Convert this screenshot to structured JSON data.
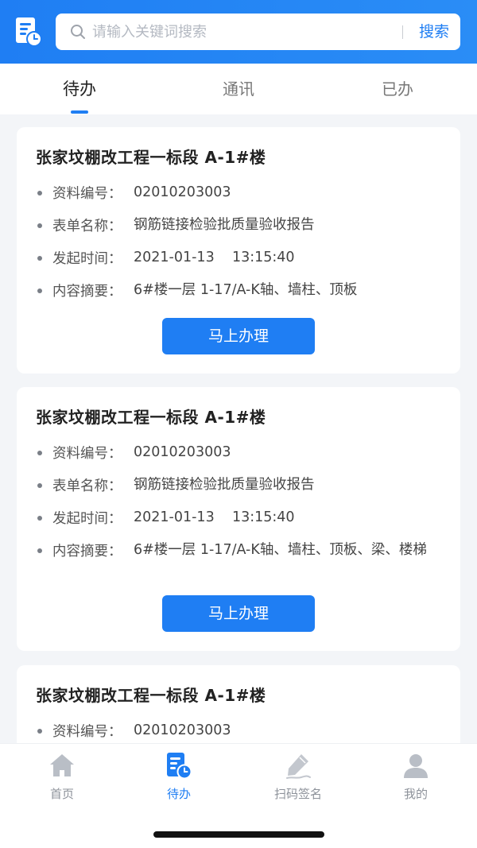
{
  "search": {
    "placeholder": "请输入关键词搜索",
    "button_label": "搜索"
  },
  "tabs": [
    {
      "label": "待办",
      "active": true
    },
    {
      "label": "通讯",
      "active": false
    },
    {
      "label": "已办",
      "active": false
    }
  ],
  "cards": [
    {
      "title": "张家坟棚改工程一标段  A-1#楼",
      "fields": [
        {
          "label": "资料编号：",
          "value": "02010203003"
        },
        {
          "label": "表单名称：",
          "value": "钢筋链接检验批质量验收报告"
        },
        {
          "label": "发起时间：",
          "value": "2021-01-13    13:15:40"
        },
        {
          "label": "内容摘要：",
          "value": "6#楼一层 1-17/A-K轴、墙柱、顶板"
        }
      ],
      "button_label": "马上办理"
    },
    {
      "title": "张家坟棚改工程一标段  A-1#楼",
      "fields": [
        {
          "label": "资料编号：",
          "value": "02010203003"
        },
        {
          "label": "表单名称：",
          "value": "钢筋链接检验批质量验收报告"
        },
        {
          "label": "发起时间：",
          "value": "2021-01-13    13:15:40"
        },
        {
          "label": "内容摘要：",
          "value": "6#楼一层 1-17/A-K轴、墙柱、顶板、梁、楼梯"
        }
      ],
      "button_label": "马上办理"
    },
    {
      "title": "张家坟棚改工程一标段  A-1#楼",
      "fields": [
        {
          "label": "资料编号：",
          "value": "02010203003"
        }
      ]
    }
  ],
  "bottom_nav": [
    {
      "label": "首页",
      "icon": "home-icon",
      "active": false
    },
    {
      "label": "待办",
      "icon": "todo-icon",
      "active": true
    },
    {
      "label": "扫码签名",
      "icon": "sign-pen-icon",
      "active": false
    },
    {
      "label": "我的",
      "icon": "user-icon",
      "active": false
    }
  ],
  "colors": {
    "primary": "#1f7ef3",
    "background": "#f3f5f8",
    "inactive": "#8d929a"
  }
}
